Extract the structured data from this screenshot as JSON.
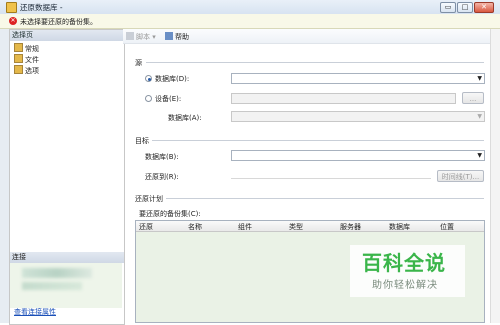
{
  "window": {
    "title": "还原数据库 -",
    "buttons": {
      "minimize": "▭",
      "maximize": "□",
      "close": "✕"
    }
  },
  "error": {
    "message": "未选择要还原的备份集。"
  },
  "left": {
    "section_title": "选择页",
    "items": [
      {
        "label": "常规",
        "icon": "page-icon"
      },
      {
        "label": "文件",
        "icon": "page-icon"
      },
      {
        "label": "选项",
        "icon": "page-icon"
      }
    ],
    "connection_title": "连接",
    "connection_link": "查看连接属性"
  },
  "toolbar": {
    "script": "脚本",
    "help": "帮助"
  },
  "source": {
    "title": "源",
    "database_radio": "数据库(D):",
    "device_radio": "设备(E):",
    "device_button": "...",
    "device_database": "数据库(A):"
  },
  "target": {
    "title": "目标",
    "database": "数据库(B):",
    "restore_to": "还原到(R):",
    "timeline_button": "时间线(T)..."
  },
  "plan": {
    "title": "还原计划",
    "backupsets_label": "要还原的备份集(C):",
    "columns": [
      "还原",
      "名称",
      "组件",
      "类型",
      "服务器",
      "数据库",
      "位置"
    ]
  },
  "watermark": {
    "main": "百科全说",
    "sub": "助你轻松解决"
  },
  "colors": {
    "watermark_green": "#3ab54a",
    "link_blue": "#1a4fb8",
    "error_red": "#d22222"
  }
}
